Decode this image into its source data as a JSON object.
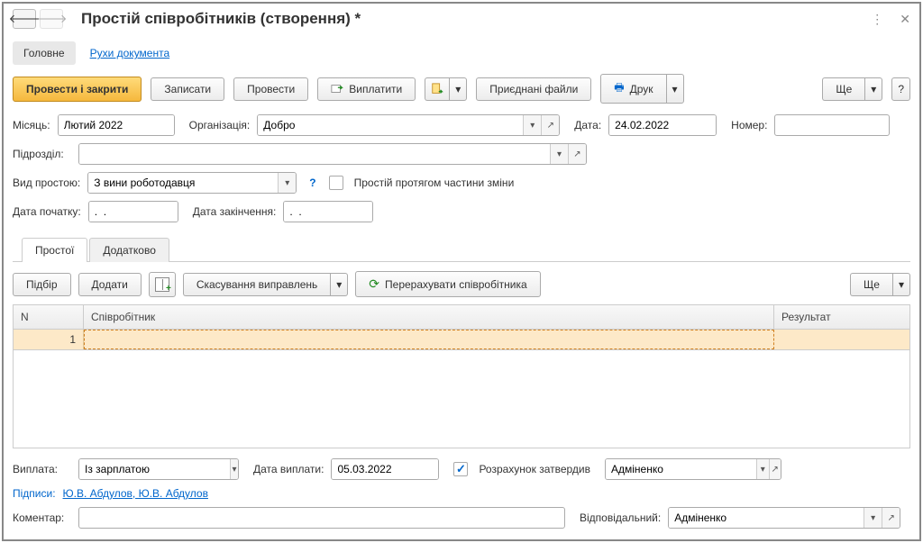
{
  "header": {
    "title": "Простій співробітників (створення) *"
  },
  "top_tabs": {
    "main": "Головне",
    "movements": "Рухи документа"
  },
  "toolbar": {
    "post_close": "Провести і закрити",
    "save": "Записати",
    "post": "Провести",
    "pay": "Виплатити",
    "attached": "Приєднані файли",
    "print": "Друк",
    "more": "Ще",
    "help": "?"
  },
  "fields": {
    "month_label": "Місяць:",
    "month_value": "Лютий 2022",
    "org_label": "Організація:",
    "org_value": "Добро",
    "date_label": "Дата:",
    "date_value": "24.02.2022",
    "number_label": "Номер:",
    "number_value": "",
    "dept_label": "Підрозділ:",
    "dept_value": "",
    "downtime_type_label": "Вид простою:",
    "downtime_type_value": "З вини роботодавця",
    "partial_shift_label": "Простій протягом частини зміни",
    "start_date_label": "Дата початку:",
    "start_date_value": ".  .",
    "end_date_label": "Дата закінчення:",
    "end_date_value": ".  ."
  },
  "sub_tabs": {
    "downtimes": "Простої",
    "additional": "Додатково"
  },
  "sub_toolbar": {
    "select": "Підбір",
    "add": "Додати",
    "cancel_fix": "Скасування виправлень",
    "recalc": "Перерахувати співробітника",
    "more": "Ще"
  },
  "table": {
    "col_n": "N",
    "col_employee": "Співробітник",
    "col_result": "Результат",
    "rows": [
      {
        "n": "1",
        "employee": "",
        "result": ""
      }
    ]
  },
  "footer": {
    "payout_label": "Виплата:",
    "payout_value": "Із зарплатою",
    "payout_date_label": "Дата виплати:",
    "payout_date_value": "05.03.2022",
    "approved_label": "Розрахунок затвердив",
    "approved_value": "Адміненко",
    "signatures_label": "Підписи: ",
    "signatures_value": "Ю.В. Абдулов, Ю.В. Абдулов",
    "comment_label": "Коментар:",
    "comment_value": "",
    "responsible_label": "Відповідальний:",
    "responsible_value": "Адміненко"
  }
}
